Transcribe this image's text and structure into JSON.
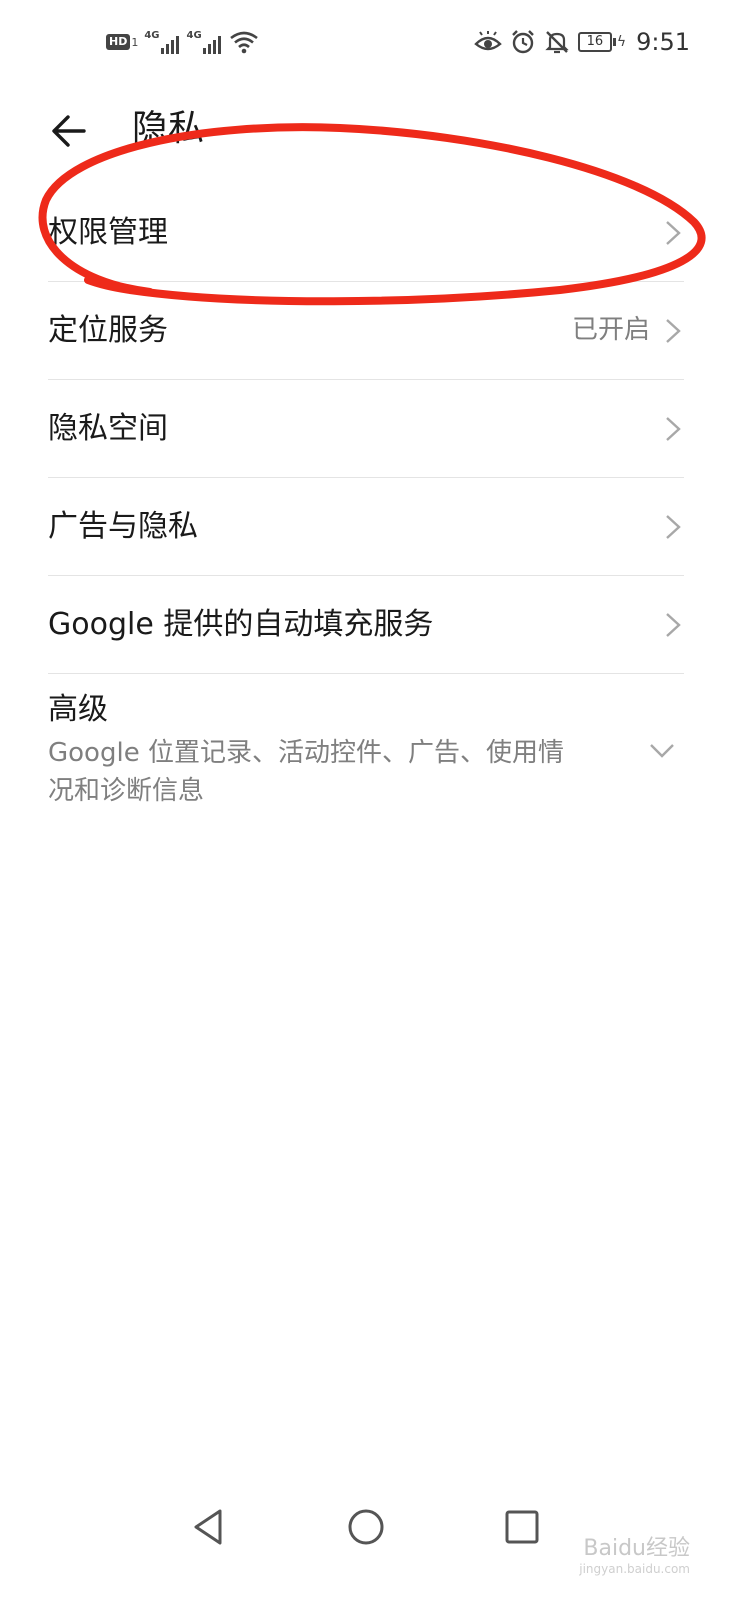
{
  "status_bar": {
    "hd_label": "HD",
    "hd_sub": "1",
    "signal1_label": "4G",
    "signal2_label": "4G",
    "battery_level": "16",
    "time": "9:51",
    "icons": [
      "hd-icon",
      "signal-icon",
      "signal-icon",
      "wifi-icon",
      "eye-icon",
      "alarm-icon",
      "bell-off-icon",
      "battery-icon",
      "charging-icon"
    ]
  },
  "header": {
    "title": "隐私",
    "back_icon": "arrow-left-icon"
  },
  "list": {
    "items": [
      {
        "label": "权限管理",
        "value": ""
      },
      {
        "label": "定位服务",
        "value": "已开启"
      },
      {
        "label": "隐私空间",
        "value": ""
      },
      {
        "label": "广告与隐私",
        "value": ""
      },
      {
        "label": "Google 提供的自动填充服务",
        "value": ""
      }
    ],
    "advanced": {
      "title": "高级",
      "description": "Google 位置记录、活动控件、广告、使用情况和诊断信息"
    }
  },
  "annotation": {
    "color": "#ee2a1a"
  },
  "nav_bar": {
    "icons": [
      "back-triangle-icon",
      "home-circle-icon",
      "recents-square-icon"
    ]
  },
  "watermark": {
    "text": "Baidu经验",
    "sub": "jingyan.baidu.com"
  }
}
